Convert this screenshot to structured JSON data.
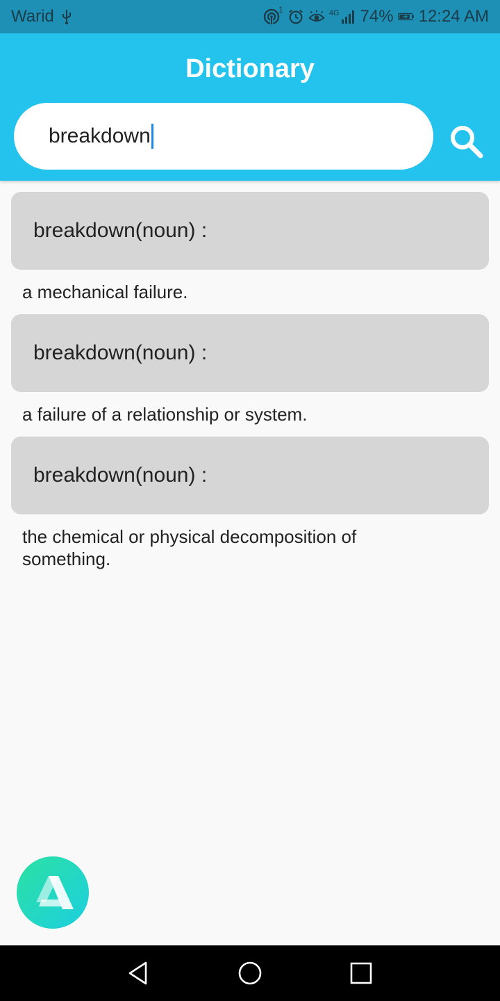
{
  "status_bar": {
    "carrier": "Warid",
    "usb_icon": "usb-icon",
    "hotspot_icon": "hotspot-icon",
    "hotspot_badge": "1",
    "alarm_icon": "alarm-icon",
    "eye_icon": "eye-comfort-icon",
    "network_type": "4G",
    "signal_icon": "signal-icon",
    "battery_percent": "74%",
    "battery_icon": "battery-charging-icon",
    "time": "12:24 AM"
  },
  "app_bar": {
    "title": "Dictionary",
    "search_value": "breakdown",
    "search_icon": "search-icon"
  },
  "results": [
    {
      "title": "breakdown(noun) :",
      "definition": "a mechanical failure."
    },
    {
      "title": "breakdown(noun) :",
      "definition": "a failure of a relationship or system."
    },
    {
      "title": "breakdown(noun) :",
      "definition": "the chemical or physical decomposition of something."
    }
  ],
  "fab": {
    "icon": "app-logo-icon"
  },
  "nav_bar": {
    "back_icon": "back-icon",
    "home_icon": "home-icon",
    "recents_icon": "recents-icon"
  },
  "colors": {
    "status_bar": "#1e8fb5",
    "app_bar": "#24c3ee",
    "card": "#d6d6d6",
    "background": "#f9f9f9",
    "caret": "#1e88e5"
  }
}
